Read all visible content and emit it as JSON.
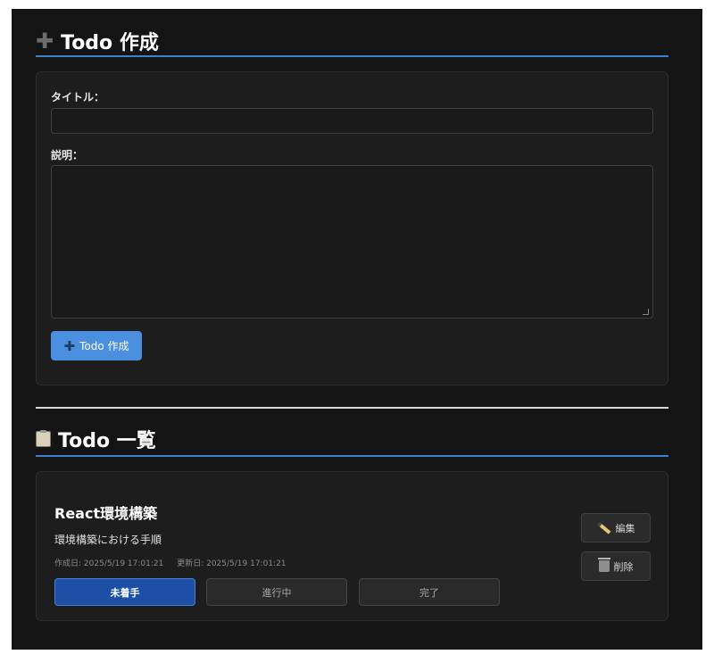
{
  "create_section": {
    "title": "Todo 作成",
    "title_icon": "plus-icon",
    "title_label": "タイトル：",
    "title_value": "",
    "title_placeholder": "",
    "description_label": "説明：",
    "description_value": "",
    "description_placeholder": "",
    "submit_label": "Todo 作成"
  },
  "list_section": {
    "title": "Todo 一覧",
    "title_icon": "clipboard-icon"
  },
  "todos": [
    {
      "title": "React環境構築",
      "description": "環境構築における手順",
      "created": "作成日: 2025/5/19 17:01:21",
      "updated": "更新日: 2025/5/19 17:01:21",
      "statuses": [
        "未着手",
        "進行中",
        "完了"
      ],
      "current_status": "未着手",
      "edit_label": "編集",
      "delete_label": "削除"
    }
  ],
  "colors": {
    "accent_blue": "#4a8fe0",
    "active_status": "#1e4fa6",
    "background": "#141414",
    "card": "#1d1d1d"
  }
}
